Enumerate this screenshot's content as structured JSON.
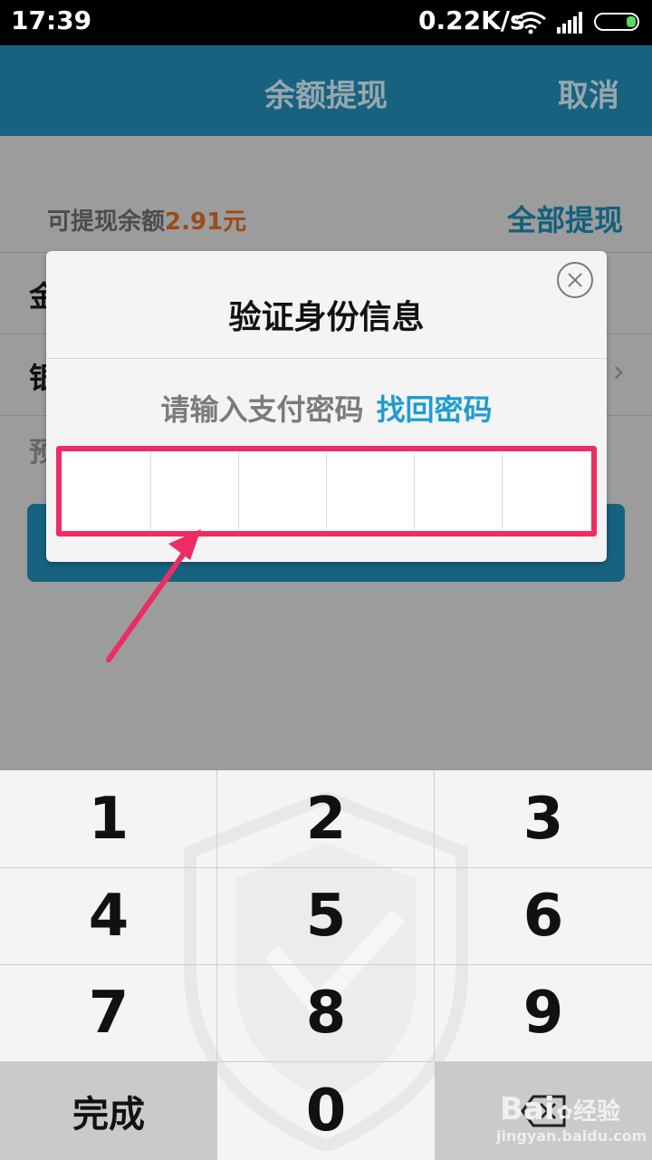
{
  "status": {
    "time": "17:39",
    "net_speed": "0.22K/s"
  },
  "header": {
    "title": "余额提现",
    "cancel": "取消"
  },
  "balance": {
    "label": "可提现余额",
    "amount": "2.91元",
    "withdraw_all": "全部提现"
  },
  "rows": {
    "amount_partial": "金",
    "bank_partial": "银",
    "arrow": "›"
  },
  "hint_partial": "预",
  "dialog": {
    "title": "验证身份信息",
    "prompt": "请输入支付密码",
    "forgot": "找回密码"
  },
  "keypad": {
    "keys": [
      "1",
      "2",
      "3",
      "4",
      "5",
      "6",
      "7",
      "8",
      "9"
    ],
    "done": "完成",
    "zero": "0"
  },
  "watermark": {
    "brand": "Bai",
    "brand_cn": "经验",
    "url": "jingyan.baidu.com"
  },
  "colors": {
    "header": "#17627f",
    "highlight": "#ec2c62",
    "link": "#1e9cd1",
    "amount": "#9a4c1a"
  }
}
